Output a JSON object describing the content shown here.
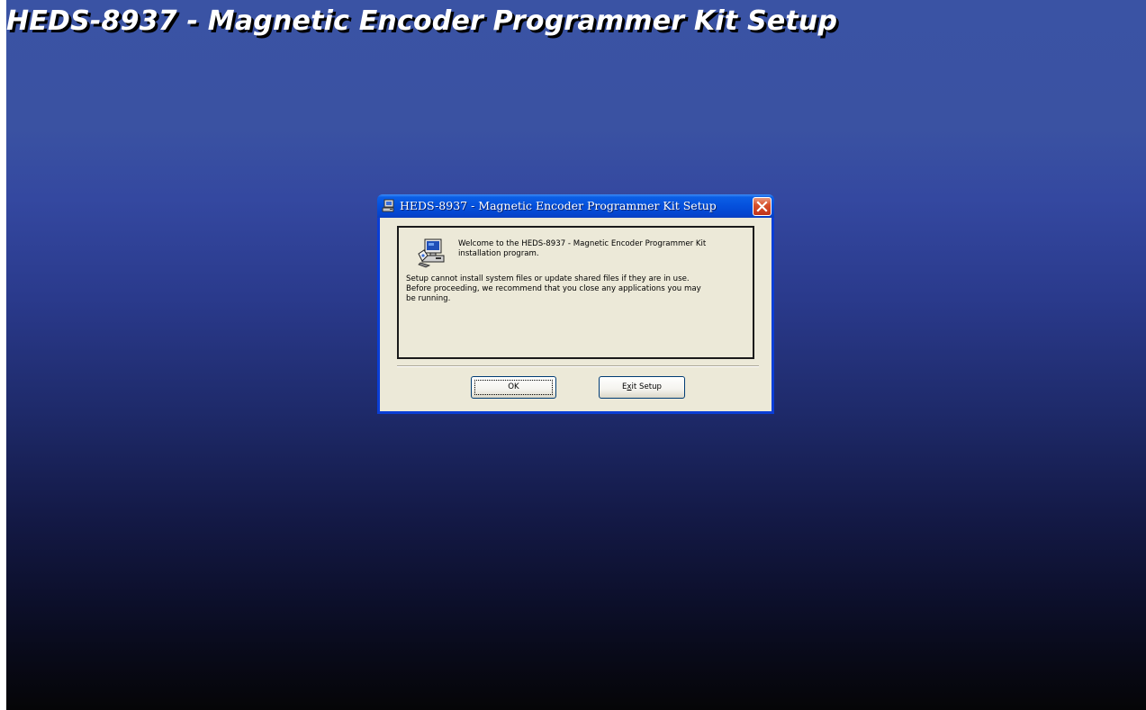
{
  "backdrop": {
    "title": "HEDS-8937 - Magnetic Encoder Programmer Kit Setup"
  },
  "dialog": {
    "title": "HEDS-8937 - Magnetic Encoder Programmer Kit Setup",
    "title_icon": "setup-program-icon",
    "close_icon": "close-icon",
    "welcome_line1": "Welcome to the HEDS-8937 - Magnetic Encoder Programmer Kit",
    "welcome_line2": "installation program.",
    "warning_line1": "Setup cannot install system files or update shared files if they are in use.",
    "warning_line2": "Before proceeding, we recommend that you close any applications you may",
    "warning_line3": "be running.",
    "ok_label": "OK",
    "exit_label_prefix": "E",
    "exit_label_mnemonic": "x",
    "exit_label_suffix": "it Setup",
    "content_icon": "computer-setup-icon"
  },
  "colors": {
    "titlebar": "#0550dc",
    "dialog_bg": "#ece9d8",
    "close_button": "#d8512b",
    "backdrop_top": "#3a53a4",
    "backdrop_bottom": "#050507"
  }
}
